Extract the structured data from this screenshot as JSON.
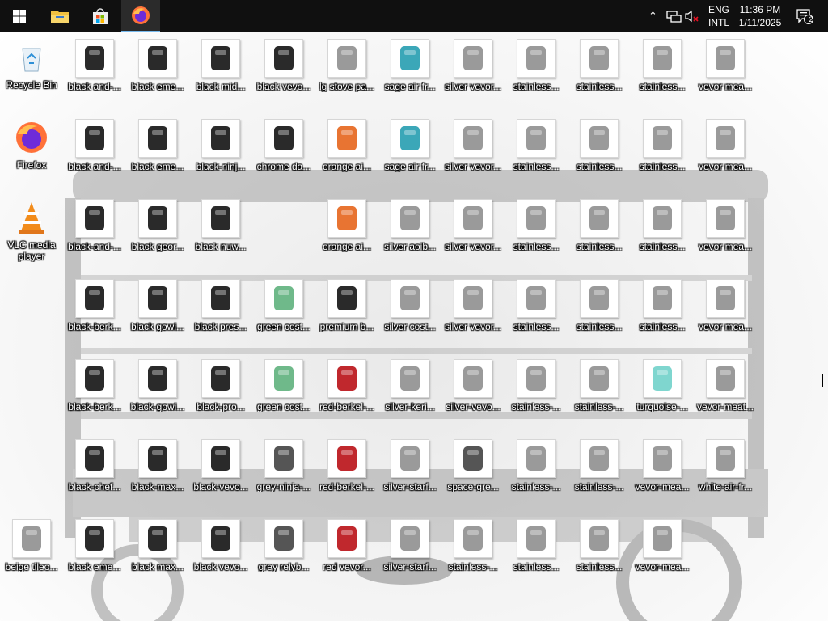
{
  "taskbar": {
    "start": "windows-start-icon",
    "apps": [
      "file-explorer-icon",
      "microsoft-store-icon",
      "firefox-icon"
    ],
    "language": "ENG",
    "layout": "INTL",
    "time": "11:36 PM",
    "date": "1/11/2025",
    "notifications": "2"
  },
  "desktop": {
    "columns": [
      [
        "Recycle Bin",
        "Firefox",
        "VLC media player",
        "",
        "",
        "",
        "beige tileo..."
      ],
      [
        "black and-...",
        "black and-...",
        "black-and-...",
        "black-berk...",
        "black-berk...",
        "black-chef...",
        "black eme..."
      ],
      [
        "black eme...",
        "black eme...",
        "black geor...",
        "black gowi...",
        "black-gowi...",
        "black-max...",
        "black max..."
      ],
      [
        "black mid...",
        "black-ninj...",
        "black nuw...",
        "black pres...",
        "black-pro...",
        "black-vevo...",
        "black vevo..."
      ],
      [
        "black vevo...",
        "chrome da...",
        "",
        "green cost...",
        "green cost...",
        "grey-ninja-...",
        "grey relyb..."
      ],
      [
        "lg stove pa...",
        "orange ai...",
        "orange ai...",
        "premium b...",
        "red-berkel-...",
        "red-berkel-...",
        "red vevor..."
      ],
      [
        "sage air fr...",
        "sage air fr...",
        "silver aoib...",
        "silver cost...",
        "silver-keri...",
        "silver-starf...",
        "silver-starf..."
      ],
      [
        "silver vevor...",
        "silver vevor...",
        "silver vevor...",
        "silver vevor...",
        "silver-vevo...",
        "space-gre...",
        "stainless-..."
      ],
      [
        "stainless...",
        "stainless...",
        "stainless...",
        "stainless...",
        "stainless-...",
        "stainless-...",
        "stainless..."
      ],
      [
        "stainless...",
        "stainless...",
        "stainless...",
        "stainless...",
        "stainless-...",
        "stainless-...",
        "stainless..."
      ],
      [
        "stainless...",
        "stainless...",
        "stainless...",
        "stainless...",
        "turquoise-...",
        "vevor-mea...",
        "vevor-mea..."
      ],
      [
        "vevor mea...",
        "vevor mea...",
        "vevor mea...",
        "vevor mea...",
        "vevor-meat...",
        "white-air-fr...",
        ""
      ]
    ]
  }
}
